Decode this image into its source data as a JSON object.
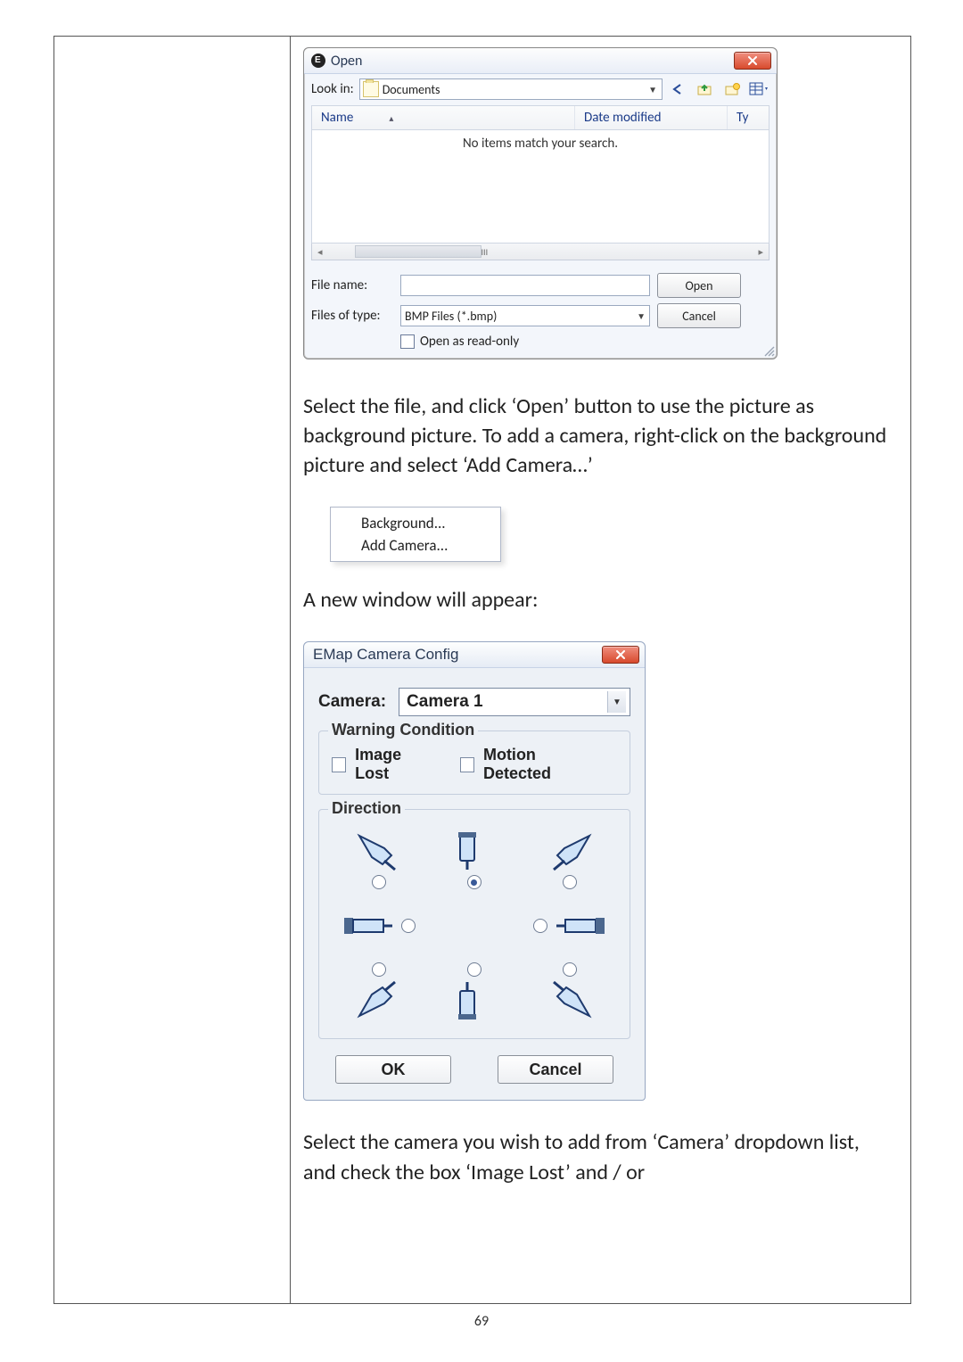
{
  "page_number": "69",
  "open_dialog": {
    "title": "Open",
    "lookin_label": "Look in:",
    "lookin_value": "Documents",
    "headers": {
      "name": "Name",
      "date": "Date modified",
      "ty": "Ty"
    },
    "empty_msg": "No items match your search.",
    "scroll_mid": "III",
    "filename_label": "File name:",
    "filename_value": "",
    "filetype_label": "Files of type:",
    "filetype_value": "BMP Files (*.bmp)",
    "open_btn": "Open",
    "cancel_btn": "Cancel",
    "readonly_label": "Open as read-only"
  },
  "para1": "Select the file, and click ‘Open’ button to use the picture as background picture. To add a camera, right-click on the background picture and select ‘Add Camera…’",
  "context_menu": {
    "bg": "Background...",
    "add": "Add Camera..."
  },
  "para2": "A new window will appear:",
  "emap": {
    "title": "EMap Camera Config",
    "camera_label": "Camera:",
    "camera_value": "Camera 1",
    "warning_legend": "Warning Condition",
    "image_lost": "Image Lost",
    "motion_detected": "Motion Detected",
    "direction_legend": "Direction",
    "ok": "OK",
    "cancel": "Cancel"
  },
  "para3": "Select the camera you wish to add from ‘Camera’ dropdown list, and check the box ‘Image Lost’ and / or"
}
